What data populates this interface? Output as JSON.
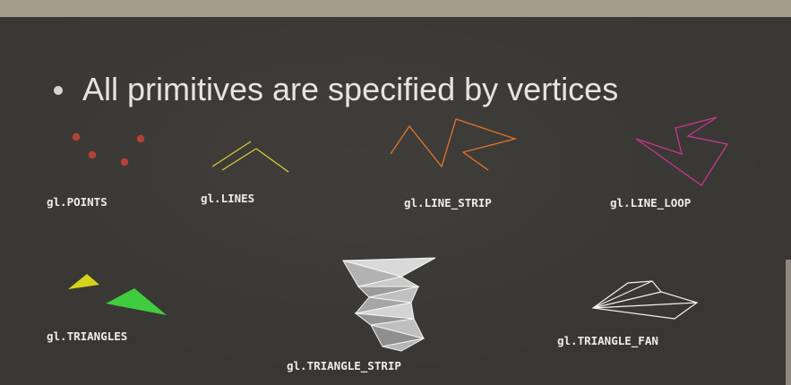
{
  "slide": {
    "bullet": "All primitives are specified by vertices"
  },
  "primitives": {
    "points": "gl.POINTS",
    "lines": "gl.LINES",
    "line_strip": "gl.LINE_STRIP",
    "line_loop": "gl.LINE_LOOP",
    "triangles": "gl.TRIANGLES",
    "triangle_strip": "gl.TRIANGLE_STRIP",
    "triangle_fan": "gl.TRIANGLE_FAN"
  },
  "colors": {
    "points": "#b4423a",
    "lines": "#d8d23a",
    "line_strip": "#e0742c",
    "line_loop": "#c6378e",
    "triangle_yellow": "#d6d21c",
    "triangle_green": "#3fcc3f",
    "strip_fill": "#bdbdbd",
    "fan_stroke": "#f2f2f2"
  }
}
